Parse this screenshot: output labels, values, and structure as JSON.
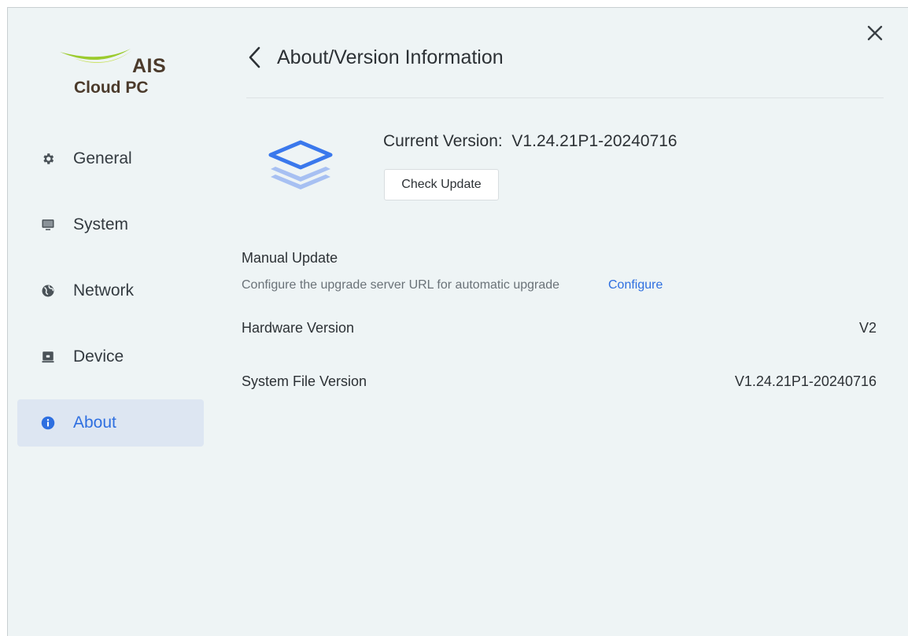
{
  "logo": {
    "brand": "AIS",
    "product": "Cloud PC"
  },
  "sidebar": {
    "items": [
      {
        "label": "General",
        "icon": "gear-icon"
      },
      {
        "label": "System",
        "icon": "monitor-icon"
      },
      {
        "label": "Network",
        "icon": "globe-icon"
      },
      {
        "label": "Device",
        "icon": "device-icon"
      },
      {
        "label": "About",
        "icon": "info-icon",
        "active": true
      }
    ]
  },
  "header": {
    "title": "About/Version Information"
  },
  "version": {
    "current_label": "Current Version:",
    "current_value": "V1.24.21P1-20240716",
    "check_button": "Check Update"
  },
  "manual_update": {
    "title": "Manual Update",
    "description": "Configure the upgrade server URL for automatic upgrade",
    "link": "Configure"
  },
  "info_rows": [
    {
      "label": "Hardware Version",
      "value": "V2"
    },
    {
      "label": "System File Version",
      "value": "V1.24.21P1-20240716"
    }
  ],
  "colors": {
    "background": "#eef4f5",
    "accent": "#2e6fe0",
    "active_nav_bg": "#dde6f2",
    "logo_green": "#9ccb2e",
    "logo_brown": "#4b3a2b"
  }
}
